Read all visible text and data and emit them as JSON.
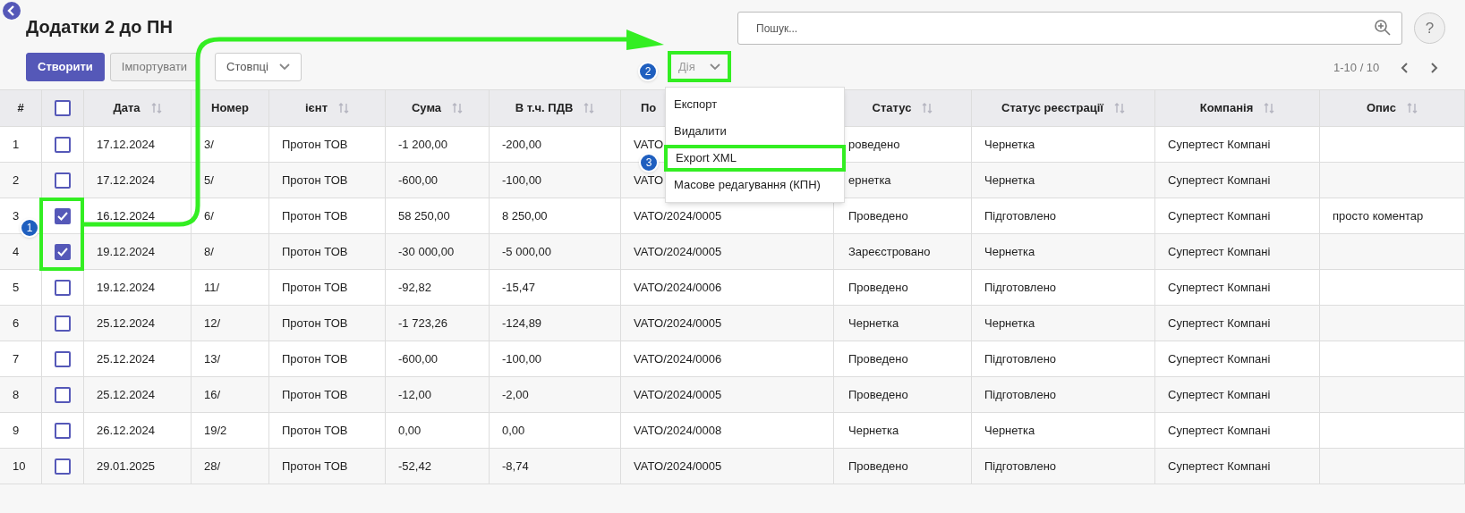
{
  "page": {
    "title": "Додатки 2 до ПН"
  },
  "toolbar": {
    "buttons": [
      {
        "label": "Створити",
        "kind": "primary"
      },
      {
        "label": "Імпортувати",
        "kind": "secondary"
      },
      {
        "label": "Стовпці",
        "kind": "dropdown"
      }
    ],
    "action": {
      "label": "Дія",
      "highlighted": true,
      "badge": "2"
    }
  },
  "search": {
    "placeholder": "Пошук..."
  },
  "help": {
    "label": "?"
  },
  "pager": {
    "range": "1-10 / 10"
  },
  "table": {
    "select_all_checked": false,
    "columns": [
      {
        "label": "#",
        "sortable": false
      },
      {
        "label": "Дата",
        "sortable": true
      },
      {
        "label": "Номер",
        "sortable": false
      },
      {
        "label": "ієнт",
        "sortable": true
      },
      {
        "label": "Сума",
        "sortable": true
      },
      {
        "label": "В т.ч. ПДВ",
        "sortable": true
      },
      {
        "label": "По",
        "sortable": false
      },
      {
        "label": "Статус",
        "sortable": true
      },
      {
        "label": "Статус реєстрації",
        "sortable": true
      },
      {
        "label": "Компанія",
        "sortable": true
      },
      {
        "label": "Опис",
        "sortable": true
      }
    ],
    "rows": [
      {
        "cells": [
          "1",
          "17.12.2024",
          "3/",
          "Протон ТОВ",
          "-1 200,00",
          "-200,00",
          "VATO",
          "роведено",
          "Чернетка",
          "Супертест Компані",
          ""
        ],
        "checked": false
      },
      {
        "cells": [
          "2",
          "17.12.2024",
          "5/",
          "Протон ТОВ",
          "-600,00",
          "-100,00",
          "VATO",
          "ернетка",
          "Чернетка",
          "Супертест Компані",
          ""
        ],
        "checked": false
      },
      {
        "cells": [
          "3",
          "16.12.2024",
          "6/",
          "Протон ТОВ",
          "58 250,00",
          "8 250,00",
          "VATO/2024/0005",
          "Проведено",
          "Підготовлено",
          "Супертест Компані",
          "просто коментар"
        ],
        "checked": true
      },
      {
        "cells": [
          "4",
          "19.12.2024",
          "8/",
          "Протон ТОВ",
          "-30 000,00",
          "-5 000,00",
          "VATO/2024/0005",
          "Зареєстровано",
          "Чернетка",
          "Супертест Компані",
          ""
        ],
        "checked": true
      },
      {
        "cells": [
          "5",
          "19.12.2024",
          "11/",
          "Протон ТОВ",
          "-92,82",
          "-15,47",
          "VATO/2024/0006",
          "Проведено",
          "Підготовлено",
          "Супертест Компані",
          ""
        ],
        "checked": false
      },
      {
        "cells": [
          "6",
          "25.12.2024",
          "12/",
          "Протон ТОВ",
          "-1 723,26",
          "-124,89",
          "VATO/2024/0005",
          "Чернетка",
          "Чернетка",
          "Супертест Компані",
          ""
        ],
        "checked": false
      },
      {
        "cells": [
          "7",
          "25.12.2024",
          "13/",
          "Протон ТОВ",
          "-600,00",
          "-100,00",
          "VATO/2024/0006",
          "Проведено",
          "Підготовлено",
          "Супертест Компані",
          ""
        ],
        "checked": false
      },
      {
        "cells": [
          "8",
          "25.12.2024",
          "16/",
          "Протон ТОВ",
          "-12,00",
          "-2,00",
          "VATO/2024/0005",
          "Проведено",
          "Підготовлено",
          "Супертест Компані",
          ""
        ],
        "checked": false
      },
      {
        "cells": [
          "9",
          "26.12.2024",
          "19/2",
          "Протон ТОВ",
          "0,00",
          "0,00",
          "VATO/2024/0008",
          "Чернетка",
          "Чернетка",
          "Супертест Компані",
          ""
        ],
        "checked": false
      },
      {
        "cells": [
          "10",
          "29.01.2025",
          "28/",
          "Протон ТОВ",
          "-52,42",
          "-8,74",
          "VATO/2024/0005",
          "Проведено",
          "Підготовлено",
          "Супертест Компані",
          ""
        ],
        "checked": false
      }
    ]
  },
  "action_menu": {
    "items": [
      {
        "label": "Експорт",
        "highlighted": false
      },
      {
        "label": "Видалити",
        "highlighted": false
      },
      {
        "label": "Export XML",
        "highlighted": true,
        "badge": "3"
      },
      {
        "label": "Масове редагування (КПН)",
        "highlighted": false
      }
    ]
  },
  "checkbox_callout": {
    "badge": "1"
  }
}
